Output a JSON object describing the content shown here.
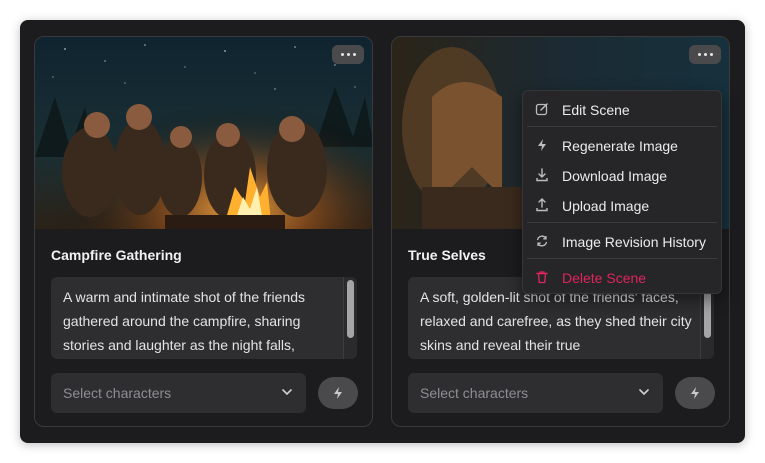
{
  "cards": [
    {
      "title": "Campfire Gathering",
      "description": "A warm and intimate shot of the friends gathered around the campfire, sharing stories and laughter as the night falls,",
      "select_placeholder": "Select characters"
    },
    {
      "title": "True Selves",
      "description": "A soft, golden-lit shot of the friends' faces, relaxed and carefree, as they shed their city skins and reveal their true",
      "select_placeholder": "Select characters"
    }
  ],
  "menu": {
    "items": [
      {
        "label": "Edit Scene",
        "icon": "edit-icon"
      },
      {
        "label": "Regenerate Image",
        "icon": "lightning-icon"
      },
      {
        "label": "Download Image",
        "icon": "download-icon"
      },
      {
        "label": "Upload Image",
        "icon": "upload-icon"
      },
      {
        "label": "Image Revision History",
        "icon": "history-icon"
      },
      {
        "label": "Delete Scene",
        "icon": "trash-icon"
      }
    ]
  },
  "colors": {
    "panel": "#1c1c1e",
    "card_border": "#3a3a3c",
    "input_bg": "#2e2e30",
    "danger": "#e0245e"
  }
}
